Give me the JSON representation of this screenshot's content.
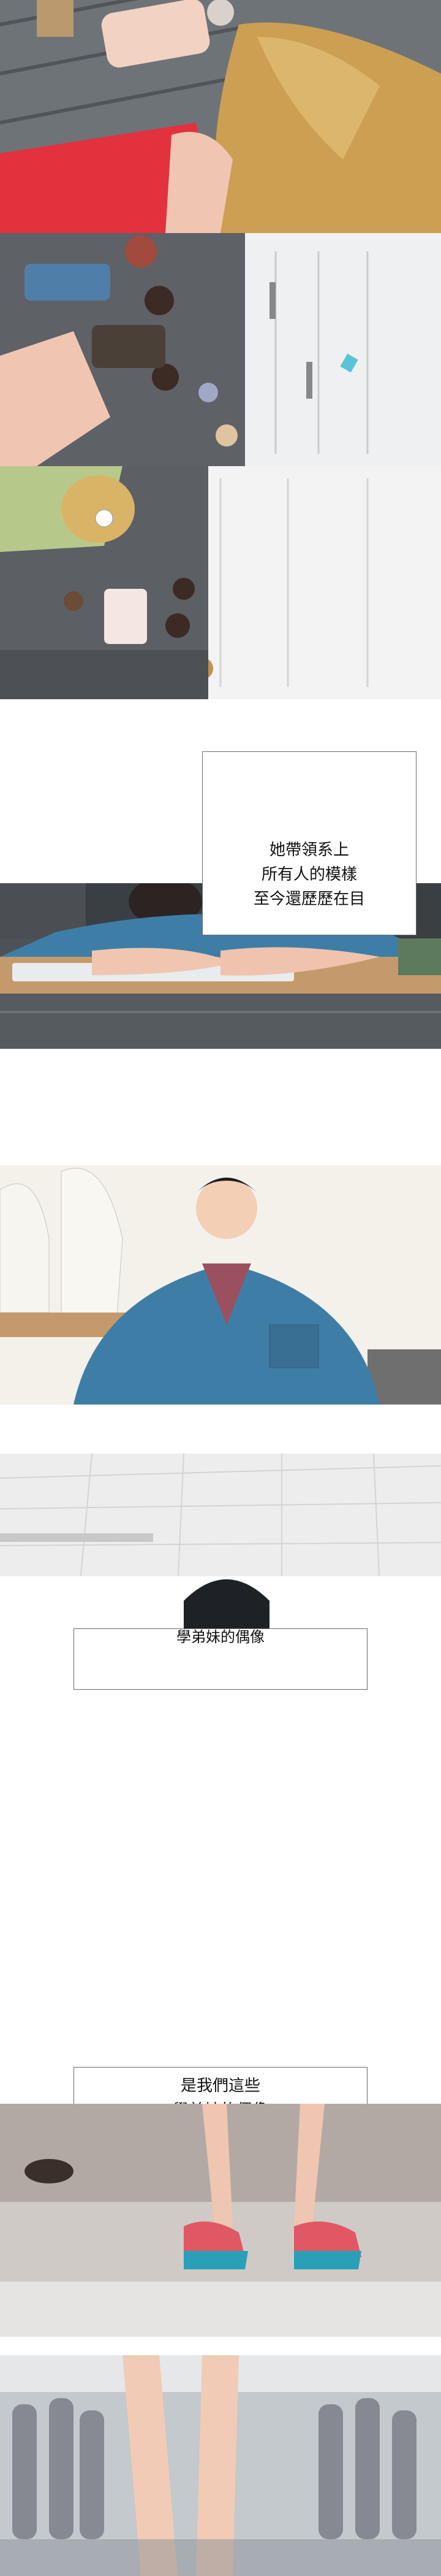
{
  "captions": {
    "c1": "她帶領系上\n所有人的模樣\n至今還歷歷在目",
    "c2": "學弟妹的偶像",
    "c3": "是我們這些\n學弟妹的偶像"
  },
  "colors": {
    "classroom_floor": "#5b5f63",
    "desk": "#c49a6c",
    "sweater": "#3e7ea6",
    "hair_blonde": "#d8b46a",
    "red_top": "#e3313d",
    "sky": "#f2f2f2"
  }
}
